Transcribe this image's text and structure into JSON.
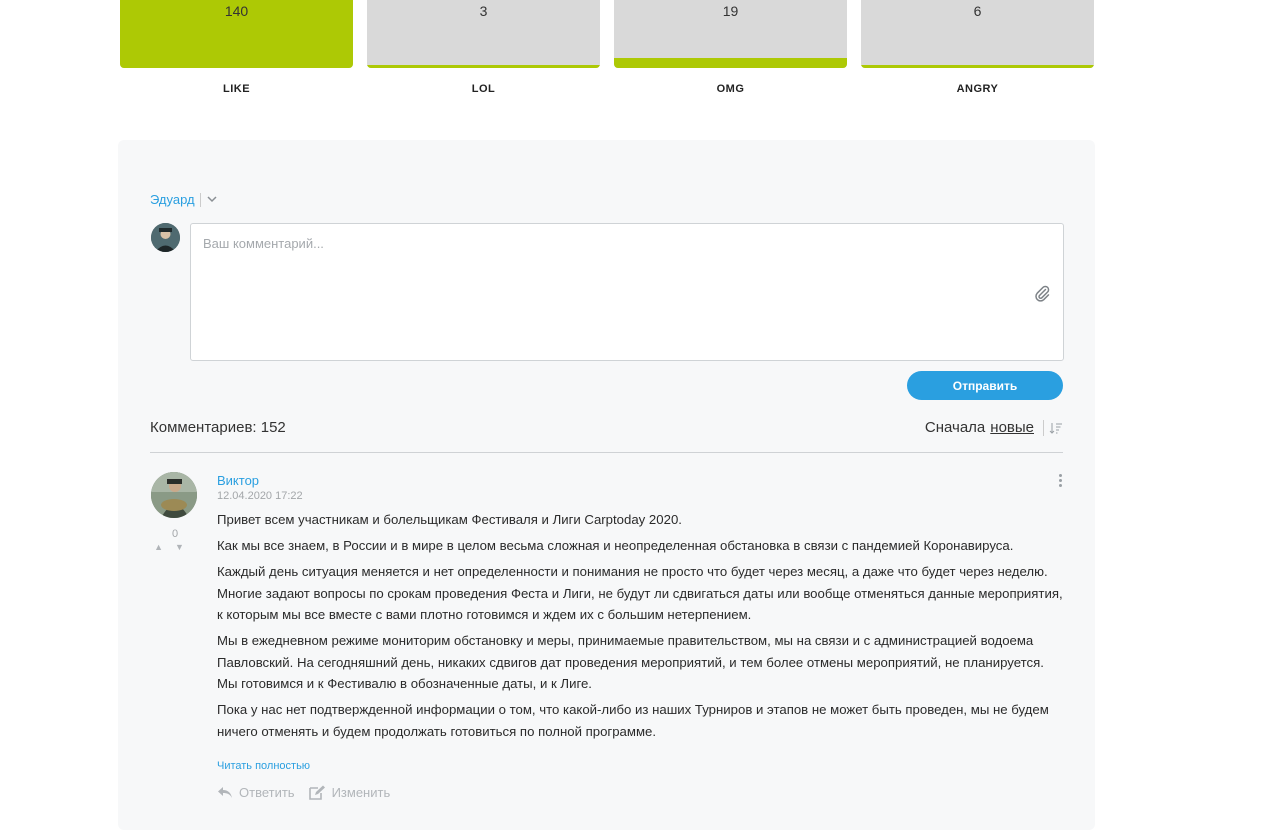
{
  "reactions": [
    {
      "name": "LIKE",
      "count": "140",
      "fill": 1.0
    },
    {
      "name": "LOL",
      "count": "3",
      "fill": 0.02
    },
    {
      "name": "OMG",
      "count": "19",
      "fill": 0.14
    },
    {
      "name": "ANGRY",
      "count": "6",
      "fill": 0.04
    }
  ],
  "colors": {
    "accent": "#2a9fe0",
    "reaction_fill": "#adc905",
    "reaction_bg": "#d9d9d9"
  },
  "comment_form": {
    "user_name": "Эдуард",
    "placeholder": "Ваш комментарий...",
    "send_label": "Отправить"
  },
  "comments_header": {
    "count_label": "Комментариев: 152",
    "sort_prefix": "Сначала",
    "sort_value": "новые"
  },
  "comment": {
    "author": "Виктор",
    "date": "12.04.2020 17:22",
    "votes": "0",
    "paragraphs": [
      "Привет всем участникам и болельщикам Фестиваля и Лиги Carptoday 2020.",
      "Как мы все знаем, в России и в мире в целом весьма сложная и неопределенная обстановка в связи с пандемией Коронавируса.",
      "Каждый день ситуация меняется и нет определенности и понимания не просто что будет через месяц, а даже что будет через неделю. Многие задают вопросы по срокам проведения Феста и Лиги, не будут ли сдвигаться даты или вообще отменяться данные мероприятия, к которым мы все вместе с вами плотно готовимся и ждем их с большим нетерпением.",
      "Мы в ежедневном режиме мониторим обстановку и меры, принимаемые правительством, мы на связи и с администрацией водоема Павловский. На сегодняшний день, никаких сдвигов дат проведения мероприятий, и тем более отмены мероприятий, не планируется. Мы готовимся и к Фестивалю в обозначенные даты, и к Лиге.",
      "Пока у нас нет подтвержденной информации о том, что какой-либо из наших Турниров и этапов не может быть проведен, мы не будем ничего отменять и будем продолжать готовиться по полной программе."
    ],
    "read_more": "Читать полностью",
    "reply_label": "Ответить",
    "edit_label": "Изменить"
  }
}
